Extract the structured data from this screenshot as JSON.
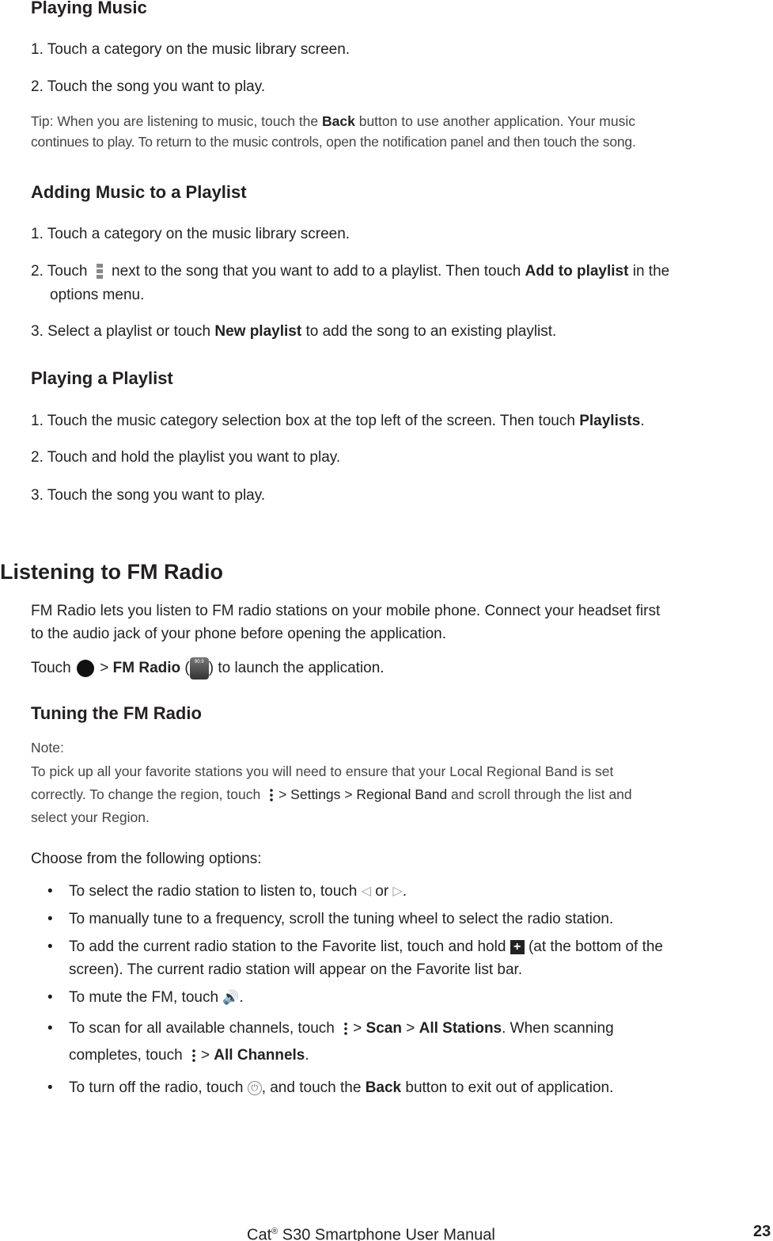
{
  "playing_music": {
    "title": "Playing Music",
    "step1": "1. Touch a category on the music library screen.",
    "step2": "2. Touch the song you want to play.",
    "tip_a": "Tip: When you are listening to music, touch the ",
    "tip_back": "Back",
    "tip_b": " button to use another application. Your music",
    "tip_c": "continues to play. To return to the music controls, open the notification panel and then touch the song."
  },
  "adding": {
    "title": "Adding Music to a Playlist",
    "step1": "1. Touch a category on the music library screen.",
    "step2_a": "2. Touch ",
    "step2_b": " next to the song that you want to add to a playlist. Then touch ",
    "step2_bold": "Add to playlist",
    "step2_c": " in the",
    "step2_d": "options menu.",
    "step3_a": "3. Select a playlist or touch ",
    "step3_bold": "New playlist",
    "step3_b": " to add the song to an existing playlist."
  },
  "playing_playlist": {
    "title": "Playing a Playlist",
    "step1_a": "1. Touch the music category selection box at the top left of the screen. Then touch ",
    "step1_bold": "Playlists",
    "step1_b": ".",
    "step2": "2. Touch and hold the playlist you want to play.",
    "step3": "3. Touch the song you want to play."
  },
  "fm": {
    "title": "Listening to FM Radio",
    "intro1": "FM Radio lets you listen to FM radio stations on your mobile phone. Connect your headset first",
    "intro2": "to the audio jack of your phone before opening the application.",
    "touch": "Touch ",
    "gt": " > ",
    "fm_radio": "FM Radio",
    "paren_open": " (",
    "launch": ") to launch the application.",
    "radio_icon_text": "90.9"
  },
  "tuning": {
    "title": "Tuning the FM Radio",
    "note": "Note:",
    "note1": "To pick up all your favorite stations you will need to ensure that your Local Regional Band is set",
    "note2_a": "correctly. To change the region, touch ",
    "note2_b": "> Settings > Regional Band",
    "note2_c": " and scroll through the list and",
    "note3": "select your Region.",
    "choose": "Choose from the following options:",
    "bullet": "•",
    "b1_a": "To select the radio station to listen to, touch ",
    "b1_or": " or ",
    "b1_end": ".",
    "b2": "To manually tune to a frequency, scroll the tuning wheel to select the radio station.",
    "b3_a": "To add the current radio station to the Favorite list, touch and hold ",
    "b3_b": " (at the bottom of the",
    "b3_c": "screen). The current radio station will appear on the Favorite list bar.",
    "b4_a": "To mute the FM, touch ",
    "b4_b": ".",
    "b5_a": "To scan for all available channels, touch ",
    "b5_gt1": "> ",
    "b5_scan": "Scan",
    "b5_gt2": " > ",
    "b5_all": "All Stations",
    "b5_b": ".  When scanning",
    "b5_c": "completes, touch ",
    "b5_gt3": "> ",
    "b5_channels": "All Channels",
    "b5_d": ".",
    "b6_a": "To turn off the radio, touch ",
    "b6_b": ", and touch the ",
    "b6_back": "Back",
    "b6_c": " button to exit out of application."
  },
  "footer": {
    "brand": "Cat",
    "reg": "®",
    "title": " S30 Smartphone User Manual",
    "page": "23"
  }
}
